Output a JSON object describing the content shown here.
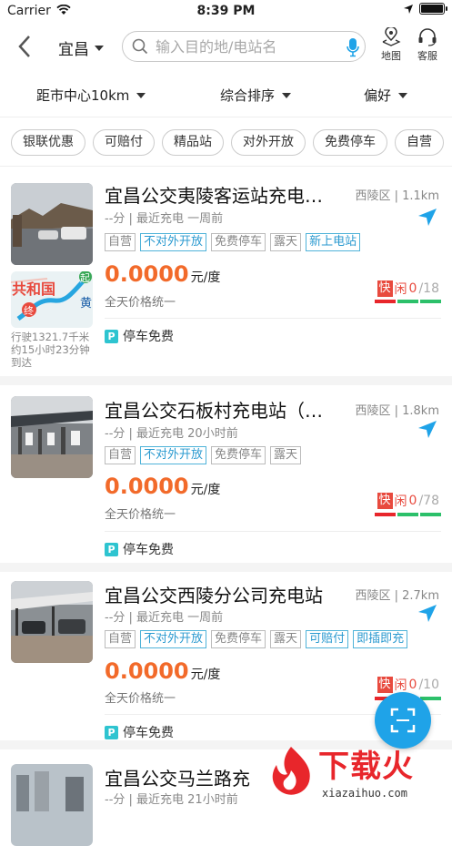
{
  "status_bar": {
    "carrier": "Carrier",
    "time": "8:39 PM"
  },
  "navbar": {
    "city": "宜昌",
    "search_placeholder": "输入目的地/电站名",
    "map_label": "地图",
    "service_label": "客服"
  },
  "filters": {
    "distance": "距市中心10km",
    "sort": "综合排序",
    "preference": "偏好"
  },
  "tags": [
    "银联优惠",
    "可赔付",
    "精品站",
    "对外开放",
    "免费停车",
    "自营"
  ],
  "stations": [
    {
      "name": "宜昌公交夷陵客运站充电…",
      "district": "西陵区 | 1.1km",
      "meta": "--分 | 最近充电 一周前",
      "attrs": [
        {
          "text": "自营",
          "blue": false
        },
        {
          "text": "不对外开放",
          "blue": true
        },
        {
          "text": "免费停车",
          "blue": false
        },
        {
          "text": "露天",
          "blue": false
        },
        {
          "text": "新上电站",
          "blue": true
        }
      ],
      "price": "0.0000",
      "unit": "元/度",
      "price_note": "全天价格统一",
      "fast": "快",
      "free_label": "闲",
      "free": "0",
      "total": "/18",
      "parking": "停车免费",
      "trip": "行驶1321.7千米约15小时23分钟到达",
      "map_labels": {
        "place": "共和国",
        "end": "终",
        "start": "起",
        "side": "黄"
      }
    },
    {
      "name": "宜昌公交石板村充电站（…",
      "district": "西陵区 | 1.8km",
      "meta": "--分 | 最近充电 20小时前",
      "attrs": [
        {
          "text": "自营",
          "blue": false
        },
        {
          "text": "不对外开放",
          "blue": true
        },
        {
          "text": "免费停车",
          "blue": false
        },
        {
          "text": "露天",
          "blue": false
        }
      ],
      "price": "0.0000",
      "unit": "元/度",
      "price_note": "全天价格统一",
      "fast": "快",
      "free_label": "闲",
      "free": "0",
      "total": "/78",
      "parking": "停车免费"
    },
    {
      "name": "宜昌公交西陵分公司充电站",
      "district": "西陵区 | 2.7km",
      "meta": "--分 | 最近充电 一周前",
      "attrs": [
        {
          "text": "自营",
          "blue": false
        },
        {
          "text": "不对外开放",
          "blue": true
        },
        {
          "text": "免费停车",
          "blue": false
        },
        {
          "text": "露天",
          "blue": false
        },
        {
          "text": "可赔付",
          "blue": true
        },
        {
          "text": "即插即充",
          "blue": true
        }
      ],
      "price": "0.0000",
      "unit": "元/度",
      "price_note": "全天价格统一",
      "fast": "快",
      "free_label": "闲",
      "free": "0",
      "total": "/10",
      "parking": "停车免费"
    },
    {
      "name": "宜昌公交马兰路充",
      "meta": "--分 | 最近充电 21小时前"
    }
  ],
  "watermark": {
    "brand": "下载火",
    "url": "xiazaihuo.com"
  },
  "colors": {
    "accent": "#1fa3e8",
    "price": "#f26a2a",
    "fast": "#e84a3e",
    "tag_blue": "#2b9ad0"
  }
}
